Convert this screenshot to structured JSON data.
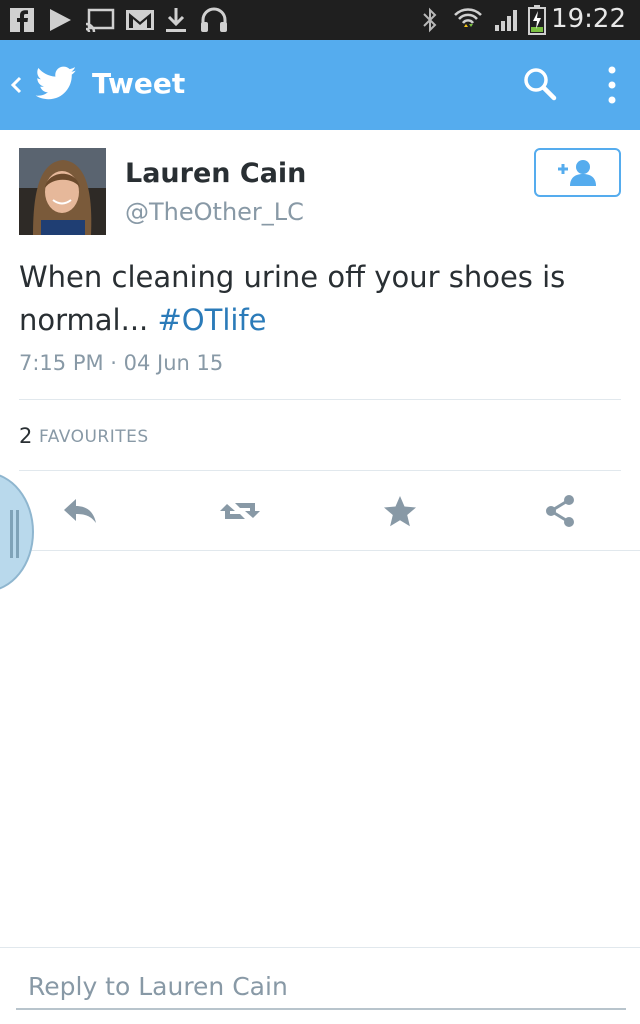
{
  "status_bar": {
    "time": "19:22",
    "icons": [
      "facebook-icon",
      "play-store-icon",
      "cast-icon",
      "gmail-icon",
      "download-icon",
      "headphones-icon",
      "bluetooth-icon",
      "wifi-icon",
      "signal-icon",
      "battery-charging-icon"
    ]
  },
  "action_bar": {
    "title": "Tweet",
    "background": "#55acee"
  },
  "tweet": {
    "author_name": "Lauren Cain",
    "author_handle": "@TheOther_LC",
    "text_plain": "When cleaning urine off your shoes is normal... ",
    "hashtag": "#OTlife",
    "timestamp": "7:15 PM · 04 Jun 15",
    "favourites_count": "2",
    "favourites_label": "FAVOURITES"
  },
  "actions": [
    "reply-icon",
    "retweet-icon",
    "favourite-icon",
    "share-icon"
  ],
  "reply": {
    "placeholder": "Reply to Lauren Cain"
  },
  "colors": {
    "accent": "#55acee",
    "hashtag": "#2b7bb9",
    "icon_gray": "#8899a6",
    "text": "#292f33"
  }
}
